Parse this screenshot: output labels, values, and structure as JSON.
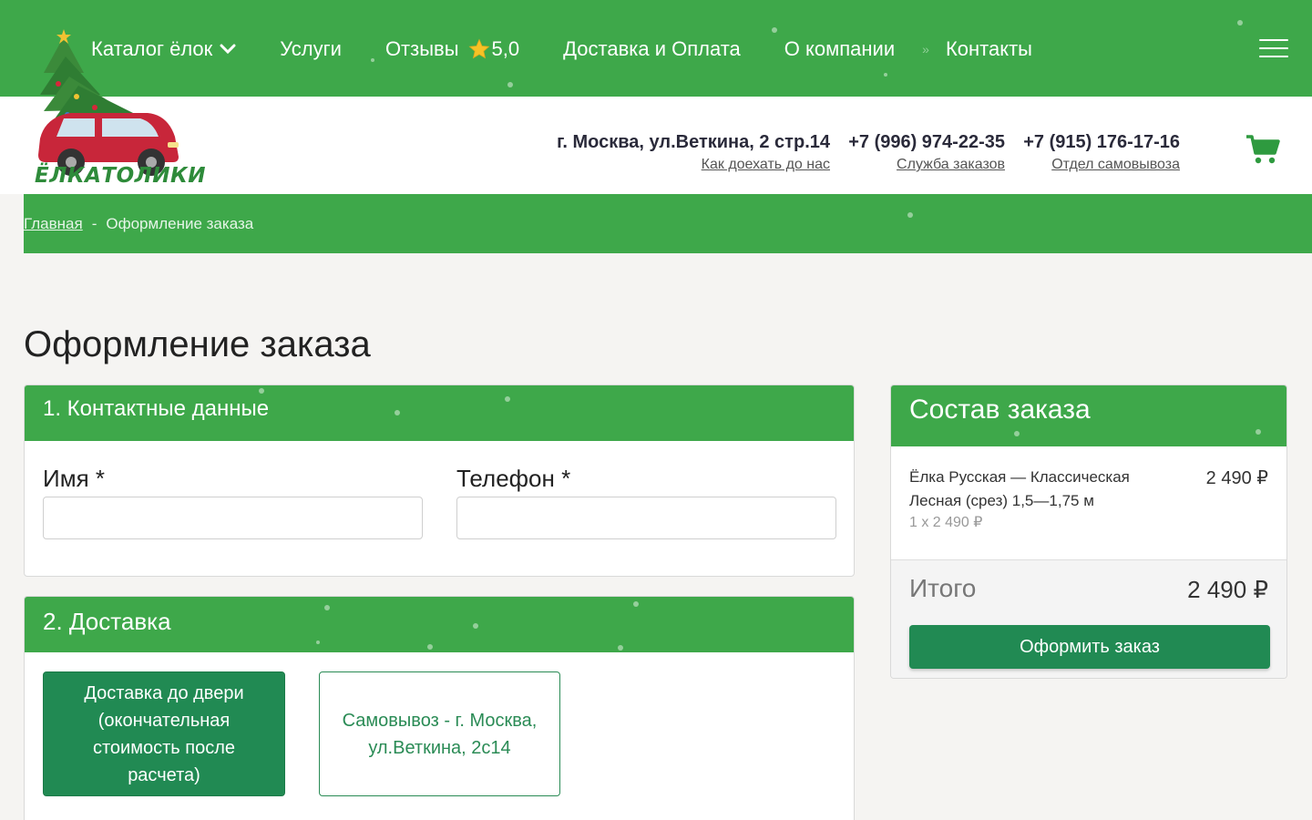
{
  "nav": {
    "catalog": "Каталог ёлок",
    "services": "Услуги",
    "reviews": "Отзывы",
    "rating": "5,0",
    "delivery": "Доставка и Оплата",
    "about": "О компании",
    "contacts": "Контакты"
  },
  "logo": {
    "text": "ЁЛКАТОЛИКИ"
  },
  "header": {
    "address": "г. Москва, ул.Веткина, 2 стр.14",
    "address_link": "Как доехать до нас",
    "phone1": "+7 (996) 974-22-35",
    "phone1_link": "Служба заказов",
    "phone2": "+7 (915) 176-17-16",
    "phone2_link": "Отдел самовывоза"
  },
  "breadcrumb": {
    "home": "Главная",
    "separator": "-",
    "current": "Оформление заказа"
  },
  "page_title": "Оформление заказа",
  "contact_section": {
    "title": "1. Контактные данные",
    "name_label": "Имя *",
    "name_value": "",
    "phone_label": "Телефон *",
    "phone_value": ""
  },
  "delivery_section": {
    "title": "2. Доставка",
    "option_door": "Доставка до двери (окончательная стоимость после расчета)",
    "option_pickup": "Самовывоз - г. Москва, ул.Веткина, 2с14"
  },
  "order": {
    "title": "Состав заказа",
    "item_name": "Ёлка Русская — Классическая Лесная (срез) 1,5—1,75 м",
    "item_qty": "1 x 2 490 ₽",
    "item_price": "2 490 ₽",
    "total_label": "Итого",
    "total_value": "2 490 ₽",
    "submit": "Оформить заказ"
  },
  "colors": {
    "brand_green": "#3ea84a",
    "button_green": "#218a53",
    "white": "#ffffff"
  },
  "icons": {
    "catalog_chevron": "chevron-down-icon",
    "rating": "star-icon",
    "menu": "hamburger-menu-icon",
    "cart": "cart-icon"
  }
}
